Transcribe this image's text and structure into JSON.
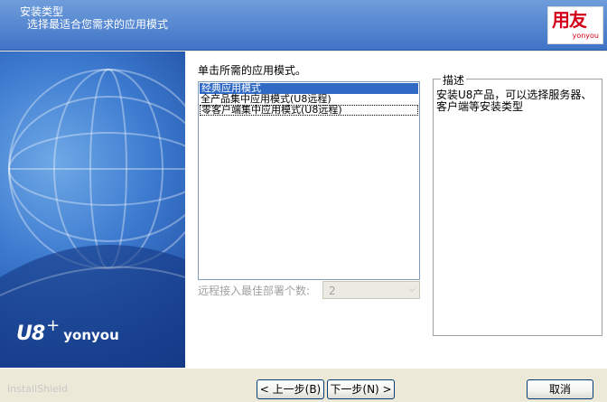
{
  "header": {
    "title": "安装类型",
    "subtitle": "选择最适合您需求的应用模式",
    "logo_main": "用友",
    "logo_sub": "yonyou"
  },
  "left_panel": {
    "brand_u8": "U8",
    "brand_plus": "+",
    "brand_yonyou": "yonyou"
  },
  "content": {
    "prompt": "单击所需的应用模式。",
    "modes": [
      {
        "label": "经典应用模式",
        "state": "selected"
      },
      {
        "label": "全产品集中应用模式(U8远程)",
        "state": "normal"
      },
      {
        "label": "零客户端集中应用模式(U8远程)",
        "state": "focused"
      }
    ],
    "description": {
      "legend": "描述",
      "text": "安装U8产品，可以选择服务器、客户端等安装类型"
    },
    "remote": {
      "label": "远程接入最佳部署个数:",
      "value": "2"
    }
  },
  "footer": {
    "installshield": "InstallShield",
    "back_label": "< 上一步(B)",
    "next_label": "下一步(N) >",
    "cancel_label": "取消"
  },
  "colors": {
    "header_blue": "#3f73c6",
    "selection_blue": "#316ac5",
    "logo_red": "#d4001a"
  }
}
